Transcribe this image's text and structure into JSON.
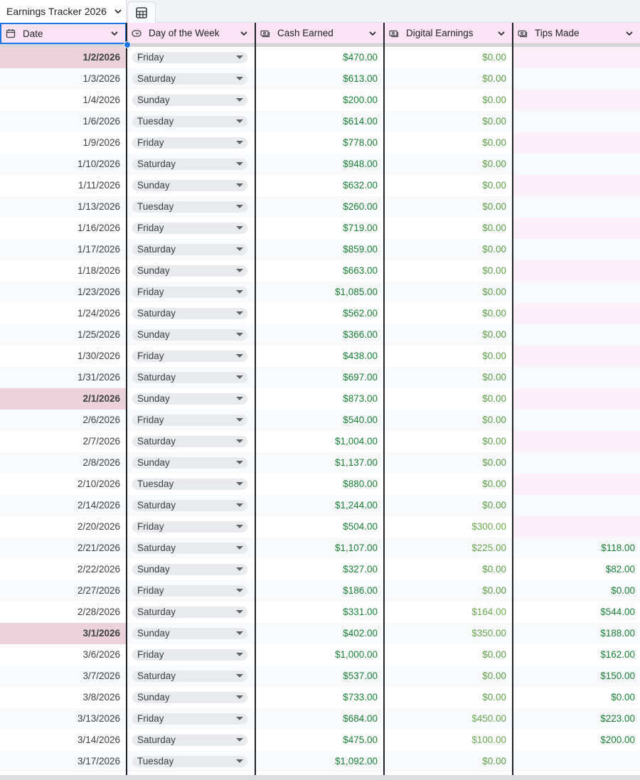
{
  "tab": {
    "title": "Earnings Tracker 2026"
  },
  "columns": [
    {
      "label": "Date",
      "icon": "calendar-icon"
    },
    {
      "label": "Day of the Week",
      "icon": "dropdown-chip-icon"
    },
    {
      "label": "Cash Earned",
      "icon": "money-icon"
    },
    {
      "label": "Digital Earnings",
      "icon": "money-icon"
    },
    {
      "label": "Tips Made",
      "icon": "money-icon"
    }
  ],
  "colors": {
    "header_bg": "#fce4f6",
    "money_green": "#188038",
    "month_start_bg": "#ecd0da",
    "selection": "#1a73e8"
  },
  "rows": [
    {
      "date": "1/2/2026",
      "day": "Friday",
      "cash": "$470.00",
      "digital": "$0.00",
      "tips": "",
      "month_start": true
    },
    {
      "date": "1/3/2026",
      "day": "Saturday",
      "cash": "$613.00",
      "digital": "$0.00",
      "tips": ""
    },
    {
      "date": "1/4/2026",
      "day": "Sunday",
      "cash": "$200.00",
      "digital": "$0.00",
      "tips": ""
    },
    {
      "date": "1/6/2026",
      "day": "Tuesday",
      "cash": "$614.00",
      "digital": "$0.00",
      "tips": ""
    },
    {
      "date": "1/9/2026",
      "day": "Friday",
      "cash": "$778.00",
      "digital": "$0.00",
      "tips": ""
    },
    {
      "date": "1/10/2026",
      "day": "Saturday",
      "cash": "$948.00",
      "digital": "$0.00",
      "tips": ""
    },
    {
      "date": "1/11/2026",
      "day": "Sunday",
      "cash": "$632.00",
      "digital": "$0.00",
      "tips": ""
    },
    {
      "date": "1/13/2026",
      "day": "Tuesday",
      "cash": "$260.00",
      "digital": "$0.00",
      "tips": ""
    },
    {
      "date": "1/16/2026",
      "day": "Friday",
      "cash": "$719.00",
      "digital": "$0.00",
      "tips": ""
    },
    {
      "date": "1/17/2026",
      "day": "Saturday",
      "cash": "$859.00",
      "digital": "$0.00",
      "tips": ""
    },
    {
      "date": "1/18/2026",
      "day": "Sunday",
      "cash": "$663.00",
      "digital": "$0.00",
      "tips": ""
    },
    {
      "date": "1/23/2026",
      "day": "Friday",
      "cash": "$1,085.00",
      "digital": "$0.00",
      "tips": ""
    },
    {
      "date": "1/24/2026",
      "day": "Saturday",
      "cash": "$562.00",
      "digital": "$0.00",
      "tips": ""
    },
    {
      "date": "1/25/2026",
      "day": "Sunday",
      "cash": "$366.00",
      "digital": "$0.00",
      "tips": ""
    },
    {
      "date": "1/30/2026",
      "day": "Friday",
      "cash": "$438.00",
      "digital": "$0.00",
      "tips": ""
    },
    {
      "date": "1/31/2026",
      "day": "Saturday",
      "cash": "$697.00",
      "digital": "$0.00",
      "tips": ""
    },
    {
      "date": "2/1/2026",
      "day": "Sunday",
      "cash": "$873.00",
      "digital": "$0.00",
      "tips": "",
      "month_start": true
    },
    {
      "date": "2/6/2026",
      "day": "Friday",
      "cash": "$540.00",
      "digital": "$0.00",
      "tips": ""
    },
    {
      "date": "2/7/2026",
      "day": "Saturday",
      "cash": "$1,004.00",
      "digital": "$0.00",
      "tips": ""
    },
    {
      "date": "2/8/2026",
      "day": "Sunday",
      "cash": "$1,137.00",
      "digital": "$0.00",
      "tips": ""
    },
    {
      "date": "2/10/2026",
      "day": "Tuesday",
      "cash": "$880.00",
      "digital": "$0.00",
      "tips": ""
    },
    {
      "date": "2/14/2026",
      "day": "Saturday",
      "cash": "$1,244.00",
      "digital": "$0.00",
      "tips": ""
    },
    {
      "date": "2/20/2026",
      "day": "Friday",
      "cash": "$504.00",
      "digital": "$300.00",
      "tips": ""
    },
    {
      "date": "2/21/2026",
      "day": "Saturday",
      "cash": "$1,107.00",
      "digital": "$225.00",
      "tips": "$118.00"
    },
    {
      "date": "2/22/2026",
      "day": "Sunday",
      "cash": "$327.00",
      "digital": "$0.00",
      "tips": "$82.00"
    },
    {
      "date": "2/27/2026",
      "day": "Friday",
      "cash": "$186.00",
      "digital": "$0.00",
      "tips": "$0.00"
    },
    {
      "date": "2/28/2026",
      "day": "Saturday",
      "cash": "$331.00",
      "digital": "$164.00",
      "tips": "$544.00"
    },
    {
      "date": "3/1/2026",
      "day": "Sunday",
      "cash": "$402.00",
      "digital": "$350.00",
      "tips": "$188.00",
      "month_start": true
    },
    {
      "date": "3/6/2026",
      "day": "Friday",
      "cash": "$1,000.00",
      "digital": "$0.00",
      "tips": "$162.00"
    },
    {
      "date": "3/7/2026",
      "day": "Saturday",
      "cash": "$537.00",
      "digital": "$0.00",
      "tips": "$150.00"
    },
    {
      "date": "3/8/2026",
      "day": "Sunday",
      "cash": "$733.00",
      "digital": "$0.00",
      "tips": "$0.00"
    },
    {
      "date": "3/13/2026",
      "day": "Friday",
      "cash": "$684.00",
      "digital": "$450.00",
      "tips": "$223.00"
    },
    {
      "date": "3/14/2026",
      "day": "Saturday",
      "cash": "$475.00",
      "digital": "$100.00",
      "tips": "$200.00"
    },
    {
      "date": "3/17/2026",
      "day": "Tuesday",
      "cash": "$1,092.00",
      "digital": "$0.00",
      "tips": ""
    }
  ]
}
